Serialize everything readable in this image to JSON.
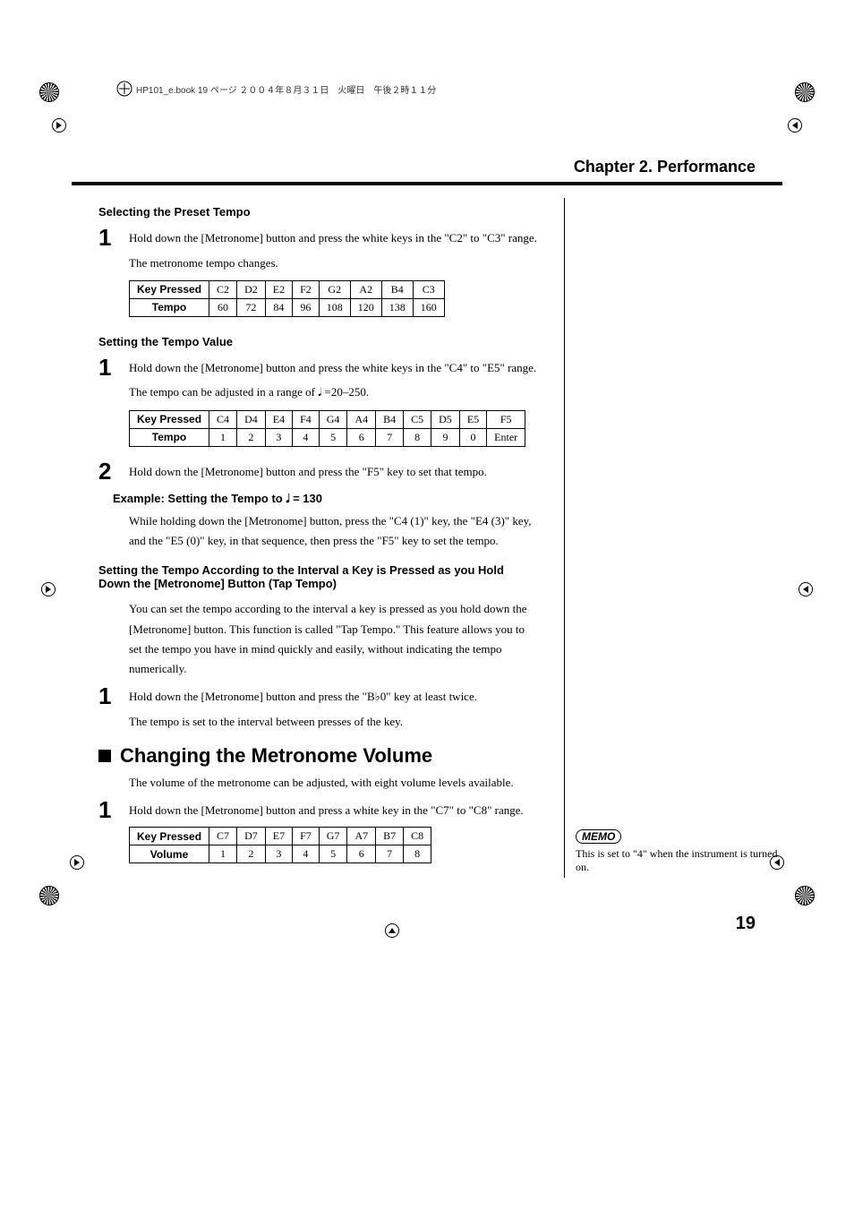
{
  "print_header": "HP101_e.book  19 ページ  ２００４年８月３１日　火曜日　午後２時１１分",
  "chapter_title": "Chapter 2. Performance",
  "preset": {
    "heading": "Selecting the Preset Tempo",
    "step1": "Hold down the [Metronome] button and press the white keys in the \"C2\" to \"C3\" range.",
    "note": "The metronome tempo changes.",
    "table": {
      "row_head": "Key Pressed",
      "row_keys": [
        "C2",
        "D2",
        "E2",
        "F2",
        "G2",
        "A2",
        "B4",
        "C3"
      ],
      "row2_head": "Tempo",
      "row_vals": [
        "60",
        "72",
        "84",
        "96",
        "108",
        "120",
        "138",
        "160"
      ]
    }
  },
  "tempo_value": {
    "heading": "Setting the Tempo Value",
    "step1": "Hold down the [Metronome] button and press the white keys in the \"C4\" to \"E5\" range.",
    "note": "The tempo can be adjusted in a range of  𝅘𝅥 =20–250.",
    "table": {
      "row_head": "Key Pressed",
      "row_keys": [
        "C4",
        "D4",
        "E4",
        "F4",
        "G4",
        "A4",
        "B4",
        "C5",
        "D5",
        "E5",
        "F5"
      ],
      "row2_head": "Tempo",
      "row_vals": [
        "1",
        "2",
        "3",
        "4",
        "5",
        "6",
        "7",
        "8",
        "9",
        "0",
        "Enter"
      ]
    },
    "step2": "Hold down the [Metronome] button and press the \"F5\" key to set that tempo.",
    "example_heading": "Example: Setting the Tempo to  𝅘𝅥  = 130",
    "example_body": "While holding down the [Metronome] button, press the \"C4 (1)\" key, the \"E4 (3)\" key, and the \"E5 (0)\" key, in that sequence, then press the \"F5\" key to set the tempo."
  },
  "tap": {
    "heading": "Setting the Tempo According to the Interval a Key is Pressed as you Hold Down the [Metronome] Button (Tap Tempo)",
    "intro": "You can set the tempo according to the interval a key is pressed as you hold down the [Metronome] button. This function is called \"Tap Tempo.\" This feature allows you to set the tempo you have in mind quickly and easily, without indicating the tempo numerically.",
    "step1": "Hold down the [Metronome] button and press the \"B♭0\" key at least twice.",
    "note": "The tempo is set to the interval between presses of the key."
  },
  "volume": {
    "heading": "Changing the Metronome Volume",
    "intro": "The volume of the metronome can be adjusted, with eight volume levels available.",
    "step1": "Hold down the [Metronome] button and press a white key in the \"C7\" to \"C8\" range.",
    "table": {
      "row_head": "Key Pressed",
      "row_keys": [
        "C7",
        "D7",
        "E7",
        "F7",
        "G7",
        "A7",
        "B7",
        "C8"
      ],
      "row2_head": "Volume",
      "row_vals": [
        "1",
        "2",
        "3",
        "4",
        "5",
        "6",
        "7",
        "8"
      ]
    }
  },
  "memo": {
    "label": "MEMO",
    "text": "This is set to \"4\" when the instrument is turned on."
  },
  "page_number": "19"
}
